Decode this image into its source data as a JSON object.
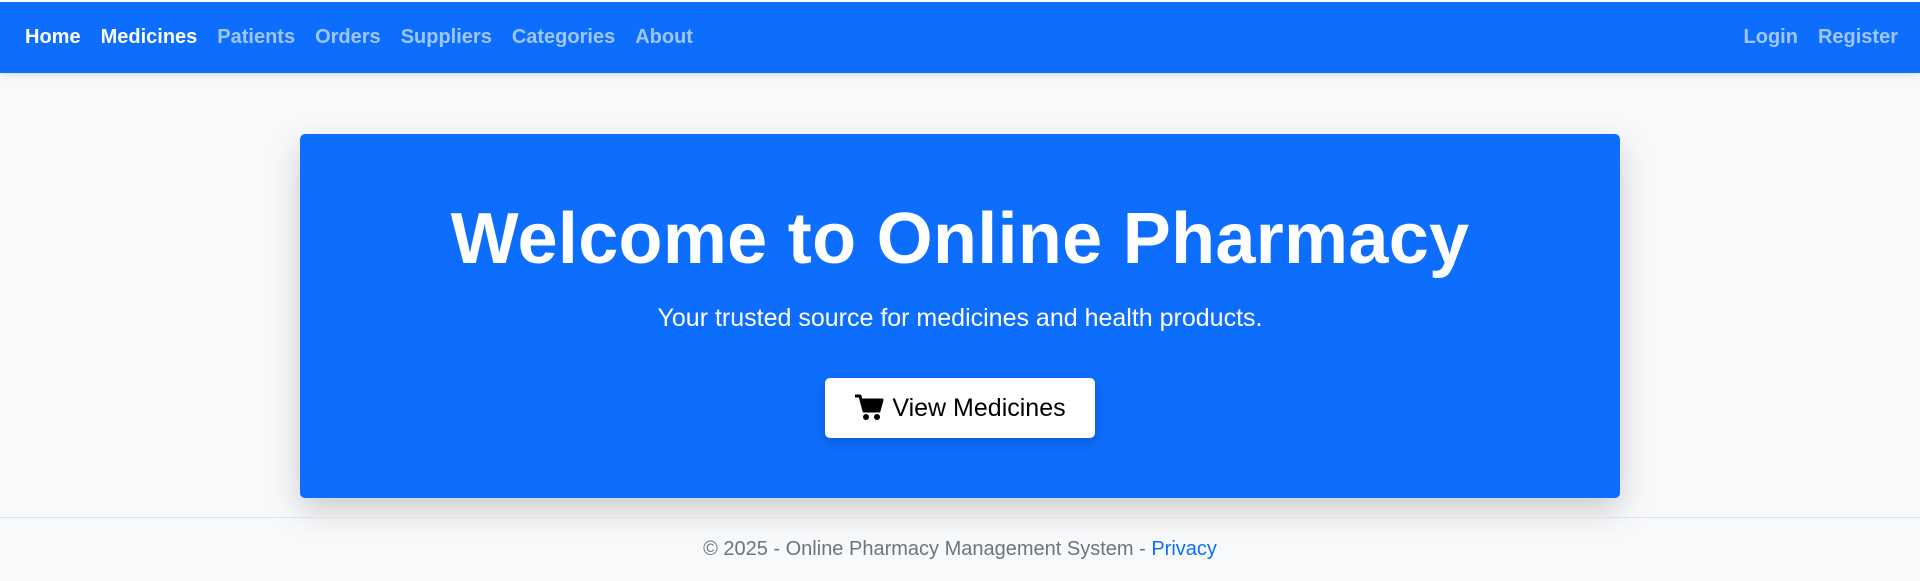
{
  "nav": {
    "left": [
      {
        "label": "Home",
        "active": true
      },
      {
        "label": "Medicines",
        "active": true
      },
      {
        "label": "Patients",
        "active": false
      },
      {
        "label": "Orders",
        "active": false
      },
      {
        "label": "Suppliers",
        "active": false
      },
      {
        "label": "Categories",
        "active": false
      },
      {
        "label": "About",
        "active": false
      }
    ],
    "right": [
      {
        "label": "Login"
      },
      {
        "label": "Register"
      }
    ]
  },
  "hero": {
    "title": "Welcome to Online Pharmacy",
    "subtitle": "Your trusted source for medicines and health products.",
    "button_label": "View Medicines",
    "button_icon": "cart-icon"
  },
  "footer": {
    "text": "© 2025 - Online Pharmacy Management System -",
    "link_label": "Privacy"
  },
  "colors": {
    "primary": "#0d6efd",
    "background": "#f8f9fa",
    "footer_text": "#6c757d"
  }
}
